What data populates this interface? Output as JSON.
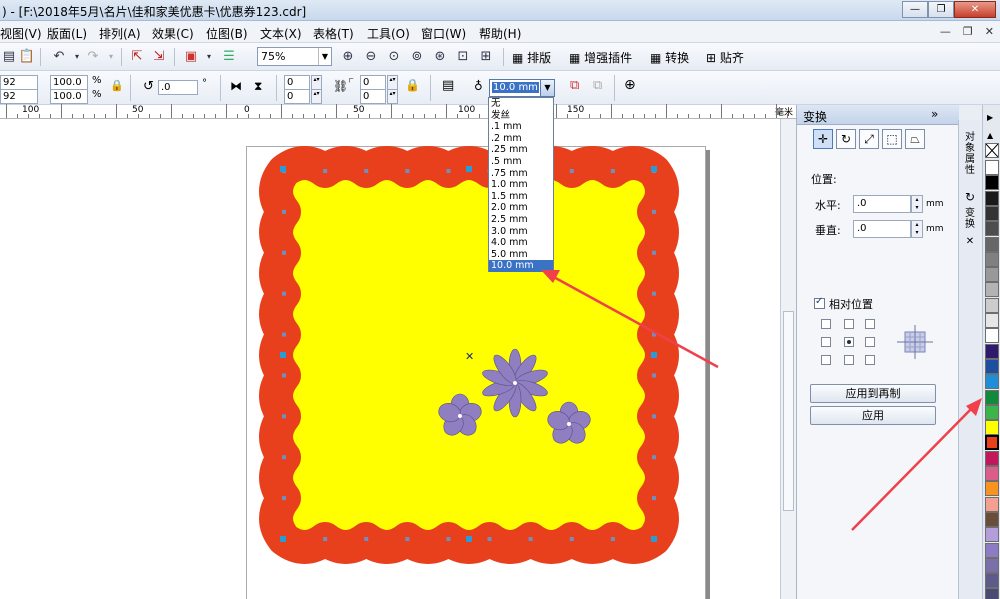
{
  "window": {
    "title": ") - [F:\\2018年5月\\名片\\佳和家美优惠卡\\优惠券123.cdr]",
    "minimize_glyph": "—",
    "maximize_glyph": "❐",
    "close_glyph": "✕"
  },
  "menu": {
    "items": [
      "视图(V)",
      "版面(L)",
      "排列(A)",
      "效果(C)",
      "位图(B)",
      "文本(X)",
      "表格(T)",
      "工具(O)",
      "窗口(W)",
      "帮助(H)"
    ],
    "mdi": [
      "—",
      "❐",
      "✕"
    ]
  },
  "toolbar": {
    "zoom_value": "75%",
    "plugins": [
      "排版",
      "增强插件",
      "转换",
      "贴齐"
    ]
  },
  "propbar": {
    "width_value": "92 mm",
    "height_value": "92 mm",
    "scale_x": "100.0",
    "scale_y": "100.0",
    "percent": "%",
    "rotation": ".0",
    "degree": "°",
    "pos_a1": "0",
    "pos_a2": "0",
    "pos_b1": "0",
    "pos_b2": "0",
    "outline_width": "10.0 mm"
  },
  "outline_dropdown": {
    "options": [
      "无",
      "发丝",
      ".1 mm",
      ".2 mm",
      ".25 mm",
      ".5 mm",
      ".75 mm",
      "1.0 mm",
      "1.5 mm",
      "2.0 mm",
      "2.5 mm",
      "3.0 mm",
      "4.0 mm",
      "5.0 mm",
      "10.0 mm"
    ],
    "selected": "10.0 mm"
  },
  "ruler": {
    "labels": [
      "100",
      "50",
      "0",
      "50",
      "100",
      "150"
    ],
    "unit": "毫米"
  },
  "docker": {
    "title": "变换",
    "collapse_glyph": "»",
    "position_label": "位置:",
    "horizontal_label": "水平:",
    "horizontal_value": ".0",
    "vertical_label": "垂直:",
    "vertical_value": ".0",
    "unit": "mm",
    "relative_label": "相对位置",
    "apply_copy_label": "应用到再制",
    "apply_label": "应用"
  },
  "side_tabs": {
    "object_props": "对象属性",
    "transform": "变换",
    "close": "✕"
  },
  "palette": {
    "colors": [
      "#ffffff",
      "#000000",
      "#1a1a1a",
      "#333333",
      "#4d4d4d",
      "#666666",
      "#808080",
      "#999999",
      "#b3b3b3",
      "#cccccc",
      "#e6e6e6",
      "#ffffff",
      "#2e1a6e",
      "#1c4fa0",
      "#1f8ed8",
      "#118a3b",
      "#39b54a",
      "#ffff00",
      "#e8401c",
      "#c2185b",
      "#d95f8a",
      "#f7931e",
      "#f4a090",
      "#6b4e3a",
      "#b39ddb",
      "#8e7cc3",
      "#7a6fa8",
      "#5e5a8a",
      "#4a4a72",
      "#6e8cc0"
    ],
    "selected_index": 18
  },
  "artwork": {
    "border_color": "#e8401c",
    "fill_color": "#ffff00",
    "flower_color": "#8f7fc0"
  }
}
